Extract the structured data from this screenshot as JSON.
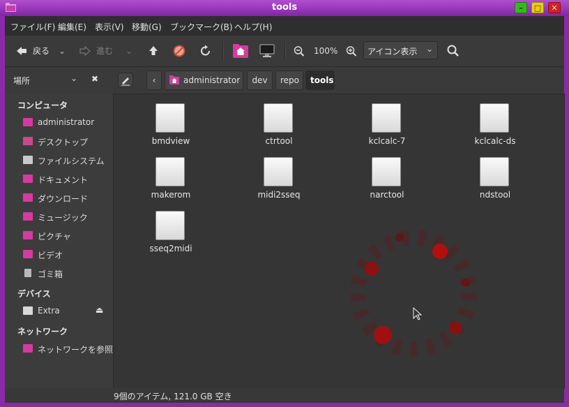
{
  "window": {
    "title": "tools",
    "controls": {
      "minimize": "–",
      "maximize": "□",
      "close": "✕"
    },
    "accent_color": "#8a2aa8"
  },
  "menubar": {
    "items": [
      "ファイル(F)",
      "編集(E)",
      "表示(V)",
      "移動(G)",
      "ブックマーク(B)",
      "ヘルプ(H)"
    ]
  },
  "toolbar": {
    "back_label": "戻る",
    "forward_label": "進む",
    "zoom_value": "100%",
    "view_mode": "アイコン表示",
    "icons": [
      "back-arrow-icon",
      "forward-arrow-icon",
      "up-arrow-icon",
      "stop-icon",
      "reload-icon",
      "home-icon",
      "computer-icon",
      "zoom-out-icon",
      "zoom-in-icon",
      "search-icon"
    ]
  },
  "sidebar": {
    "header": "場所",
    "sections": [
      {
        "title": "コンピュータ",
        "items": [
          {
            "label": "administrator",
            "icon": "home-folder-icon"
          },
          {
            "label": "デスクトップ",
            "icon": "desktop-icon"
          },
          {
            "label": "ファイルシステム",
            "icon": "filesystem-icon"
          },
          {
            "label": "ドキュメント",
            "icon": "documents-folder-icon"
          },
          {
            "label": "ダウンロード",
            "icon": "downloads-folder-icon"
          },
          {
            "label": "ミュージック",
            "icon": "music-folder-icon"
          },
          {
            "label": "ピクチャ",
            "icon": "pictures-folder-icon"
          },
          {
            "label": "ビデオ",
            "icon": "videos-folder-icon"
          },
          {
            "label": "ゴミ箱",
            "icon": "trash-icon"
          }
        ]
      },
      {
        "title": "デバイス",
        "items": [
          {
            "label": "Extra",
            "icon": "drive-icon"
          }
        ]
      },
      {
        "title": "ネットワーク",
        "items": [
          {
            "label": "ネットワークを参照",
            "icon": "network-icon"
          }
        ]
      }
    ]
  },
  "pathbar": {
    "crumbs": [
      "administrator",
      "dev",
      "repo",
      "tools"
    ]
  },
  "files": [
    "bmdview",
    "ctrtool",
    "kclcalc-7",
    "kclcalc-ds",
    "makerom",
    "midi2sseq",
    "narctool",
    "ndstool",
    "sseq2midi"
  ],
  "statusbar": {
    "text": "9個のアイテム, 121.0 GB 空き"
  }
}
